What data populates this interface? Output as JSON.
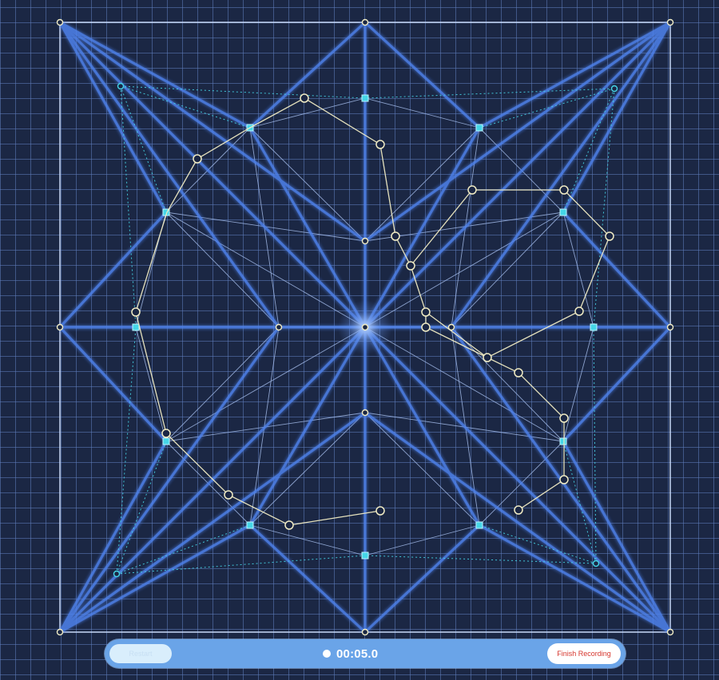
{
  "recording_bar": {
    "restart_label": "Restart",
    "timer": "00:05.0",
    "finish_label": "Finish Recording"
  },
  "colors": {
    "background": "#1b2744",
    "grid": "#5f7ebe",
    "structure_line": "#4d7fe8",
    "hair_line": "#9fb8ec",
    "frame": "#d7e6ff",
    "path_line": "#f1ecc4",
    "cyan_node": "#45d6e8",
    "bar": "#6aa4e8",
    "finish_text": "#d6362d"
  },
  "icons": {
    "record": "record-dot-icon"
  }
}
